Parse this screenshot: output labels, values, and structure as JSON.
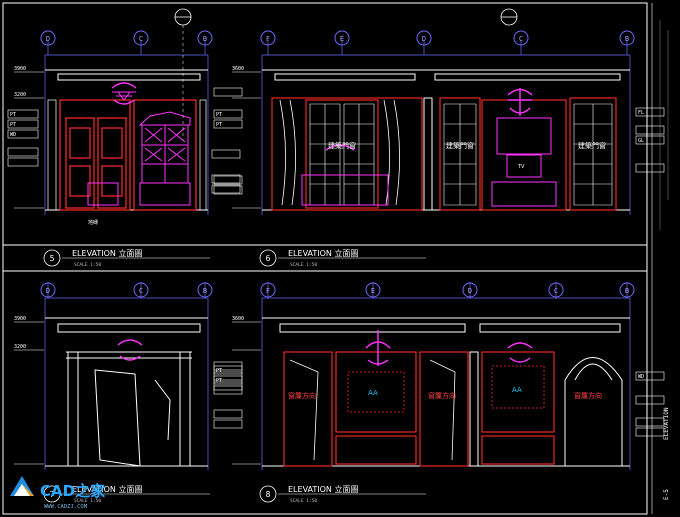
{
  "colors": {
    "background": "#000000",
    "frame": "#ffffff",
    "wall": "#ff2a2a",
    "furniture": "#ff33ff",
    "grid": "#6b6bff",
    "dimension": "#8a8a8a",
    "label": "#ff4040",
    "accent": "#19c8ff"
  },
  "grid_bubbles": {
    "top_left": [
      "D",
      "C",
      "B"
    ],
    "top_right": [
      "B",
      "F",
      "E",
      "D",
      "C",
      "B"
    ],
    "bottom_left": [
      "D",
      "C",
      "B"
    ],
    "bottom_right": [
      "F",
      "E",
      "D",
      "C",
      "B"
    ]
  },
  "levels": [
    "3900",
    "3200",
    "3600"
  ],
  "elevations": [
    {
      "number": "5",
      "title": "ELEVATION 立面圖",
      "scale": "SCALE  1:50"
    },
    {
      "number": "6",
      "title": "ELEVATION 立面圖",
      "scale": "SCALE  1:50"
    },
    {
      "number": "7",
      "title": "ELEVATION 立面圖",
      "scale": "SCALE  1:50"
    },
    {
      "number": "8",
      "title": "ELEVATION 立面圖",
      "scale": "SCALE  1:50"
    }
  ],
  "annotations": {
    "cabinet": "建築門窗",
    "tv": "TV",
    "aa": "AA",
    "curtain": "窗簾方向",
    "floor_note": "地磚"
  },
  "tags": [
    "PT",
    "PT",
    "WD",
    "FL",
    "GL"
  ],
  "watermark": {
    "brand": "CAD之家",
    "site": "WWW.CADZJ.COM"
  },
  "sidebar": {
    "label": "ELEVATION",
    "sheet": "E-5"
  }
}
